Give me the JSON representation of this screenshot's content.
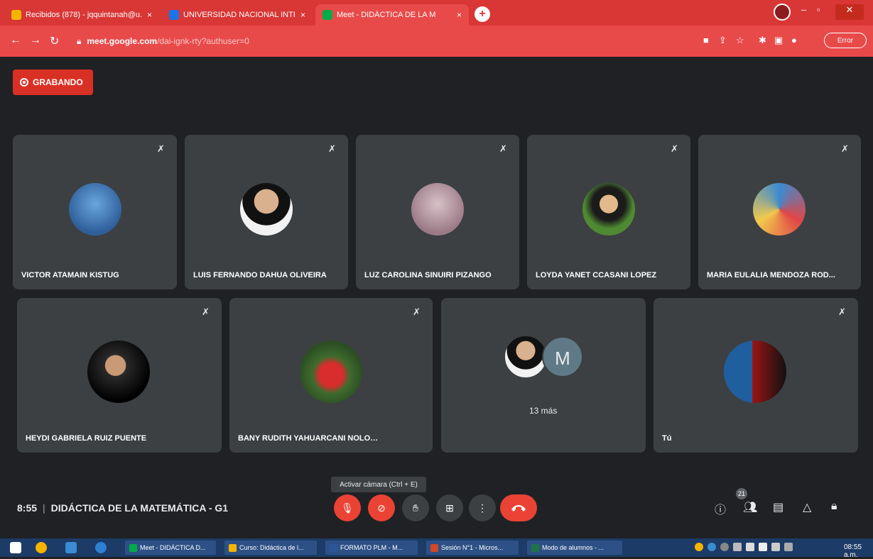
{
  "browser": {
    "tabs": [
      {
        "title": "Recibidos (878) - jqquintanah@u...",
        "favicon_color": "#f4b400"
      },
      {
        "title": "UNIVERSIDAD NACIONAL INTE",
        "favicon_color": "#1a73e8"
      },
      {
        "title": "Meet - DIDÁCTICA DE LA M",
        "favicon_color": "#00ac47"
      }
    ],
    "new_tab": "+",
    "url_host": "meet.google.com",
    "url_path": "/dai-ignk-rty?authuser=0",
    "error_button": "Error"
  },
  "meet": {
    "recording_label": "GRABANDO",
    "participants": [
      {
        "name": "VICTOR ATAMAIN KISTUG",
        "avatar_color": "#4a87c9"
      },
      {
        "name": "LUIS FERNANDO DAHUA OLIVEIRA",
        "avatar_color": "#e6e2dc"
      },
      {
        "name": "LUZ CAROLINA SINUIRI PIZANGO",
        "avatar_color": "#b89aa4"
      },
      {
        "name": "LOYDA YANET CCASANI LOPEZ",
        "avatar_color": "#5a8a3a"
      },
      {
        "name": "MARIA EULALIA MENDOZA ROD...",
        "avatar_color": "#4f95c8"
      },
      {
        "name": "HEYDI GABRIELA RUIZ PUENTE",
        "avatar_color": "#2a2a2a"
      },
      {
        "name": "BANY RUDITH YAHUARCANI NOLORBE",
        "avatar_color": "#4d7b3a"
      }
    ],
    "more_tile": {
      "initial": "M",
      "label": "13 más"
    },
    "self_tile": {
      "name": "Tú"
    },
    "tooltip": "Activar cámara (Ctrl + E)",
    "time": "8:55",
    "meeting_title": "DIDÁCTICA DE LA MATEMÁTICA - G1",
    "participant_count": "21"
  },
  "taskbar": {
    "tasks": [
      {
        "label": "Meet - DIDÁCTICA D...",
        "color": "#00ac47"
      },
      {
        "label": "Curso: Didáctica de l...",
        "color": "#f4b400"
      },
      {
        "label": "FORMATO PLM - M...",
        "color": "#2b579a"
      },
      {
        "label": "Sesión N°1 - Micros...",
        "color": "#d24726"
      },
      {
        "label": "Modo de alumnos - ...",
        "color": "#217346"
      }
    ],
    "clock": "08:55 a.m."
  }
}
